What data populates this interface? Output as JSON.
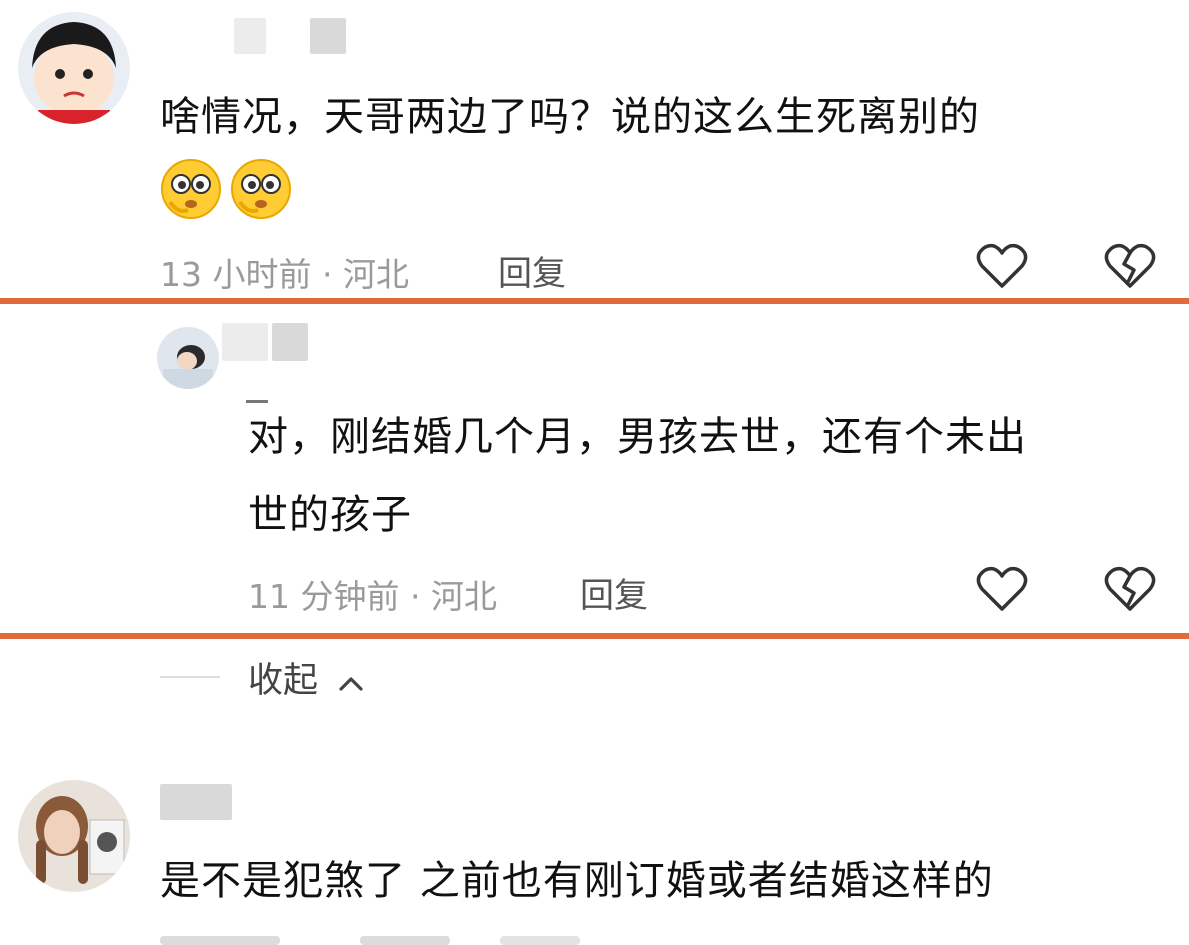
{
  "comments": [
    {
      "text": "啥情况，天哥两边了吗？说的这么生死离别的",
      "emoji_count": 2,
      "meta": "13 小时前 · 河北",
      "reply_label": "回复"
    },
    {
      "text_line1": "对，刚结婚几个月，男孩去世，还有个未出",
      "text_line2": "世的孩子",
      "meta": "11 分钟前 · 河北",
      "reply_label": "回复"
    },
    {
      "text": "是不是犯煞了 之前也有刚订婚或者结婚这样的"
    }
  ],
  "collapse_label": "收起",
  "icons": [
    "like-heart-icon",
    "broken-heart-icon",
    "chevron-up-icon",
    "emoji-pleading-icon"
  ],
  "colors": {
    "divider": "#e06a3a",
    "meta": "#9a9a9a",
    "text": "#111111"
  }
}
